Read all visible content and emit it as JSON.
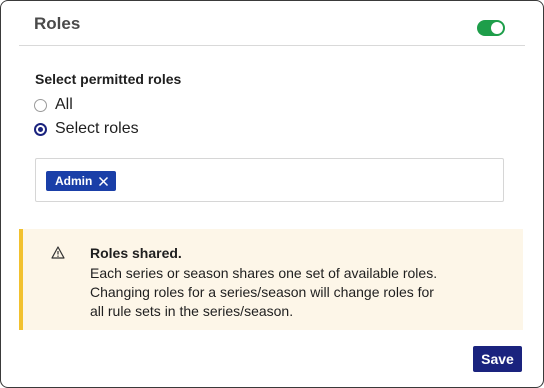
{
  "header": {
    "title": "Roles",
    "toggle_on": true
  },
  "roles_section": {
    "label": "Select permitted roles",
    "options": [
      {
        "label": "All",
        "selected": false
      },
      {
        "label": "Select roles",
        "selected": true
      }
    ],
    "selected_roles": [
      "Admin"
    ]
  },
  "notice": {
    "title": "Roles shared.",
    "lines": [
      "Each series or season shares one set of available roles.",
      "Changing roles for a series/season will change roles for",
      "all rule sets in the series/season."
    ],
    "icon": "warning-icon"
  },
  "footer": {
    "save_label": "Save"
  },
  "colors": {
    "toggle": "#1e9e4a",
    "accent": "#1a237e",
    "chip": "#1a3fa8",
    "notice_bg": "#fdf6e8",
    "notice_border": "#f2c12e"
  }
}
